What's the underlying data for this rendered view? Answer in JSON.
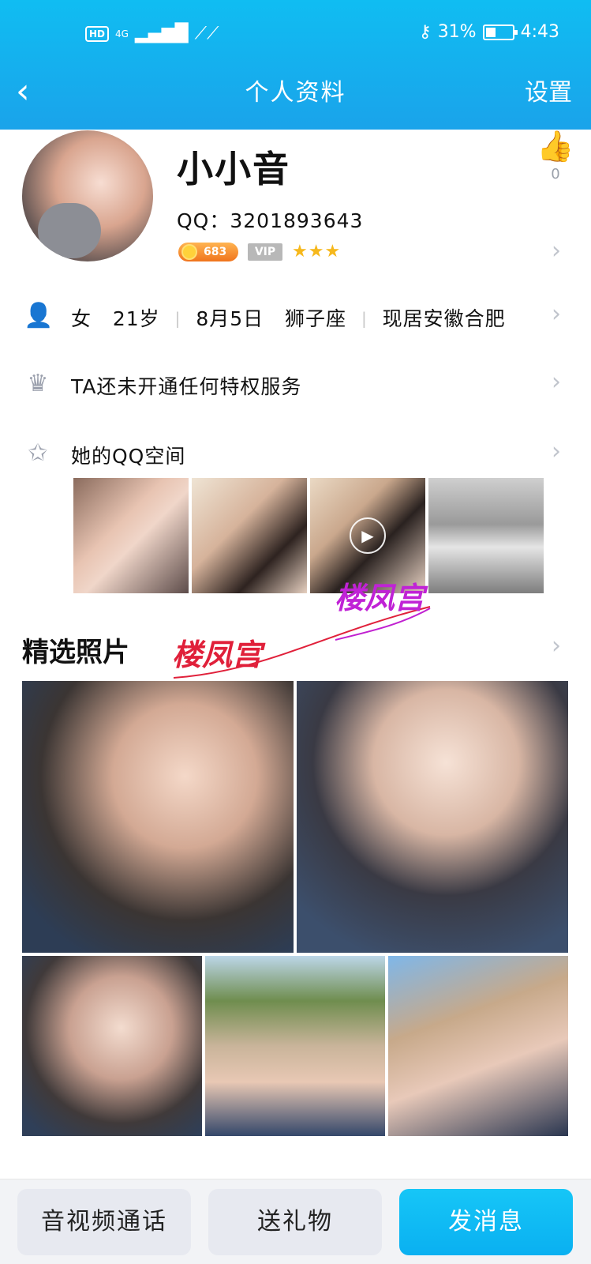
{
  "status_bar": {
    "hd": "HD",
    "network": "4G",
    "battery_percent": "31%",
    "time": "4:43"
  },
  "nav": {
    "title": "个人资料",
    "settings": "设置"
  },
  "profile": {
    "name": "小小音",
    "qq": "QQ：3201893643",
    "coin_level": "683",
    "vip_badge": "VIP",
    "stars": "★★★",
    "like_count": "0"
  },
  "info": {
    "gender": "女",
    "age": "21岁",
    "birthday": "8月5日",
    "zodiac": "狮子座",
    "location": "现居安徽合肥"
  },
  "privilege_text": "TA还未开通任何特权服务",
  "qzone_label": "她的QQ空间",
  "featured_title": "精选照片",
  "watermarks": [
    "楼凤宫",
    "楼凤宫"
  ],
  "buttons": {
    "call": "音视频通话",
    "gift": "送礼物",
    "message": "发消息"
  },
  "colors": {
    "header": "#14b4ef",
    "accent_blue": "#0ab0f1",
    "star": "#f6b81c"
  }
}
